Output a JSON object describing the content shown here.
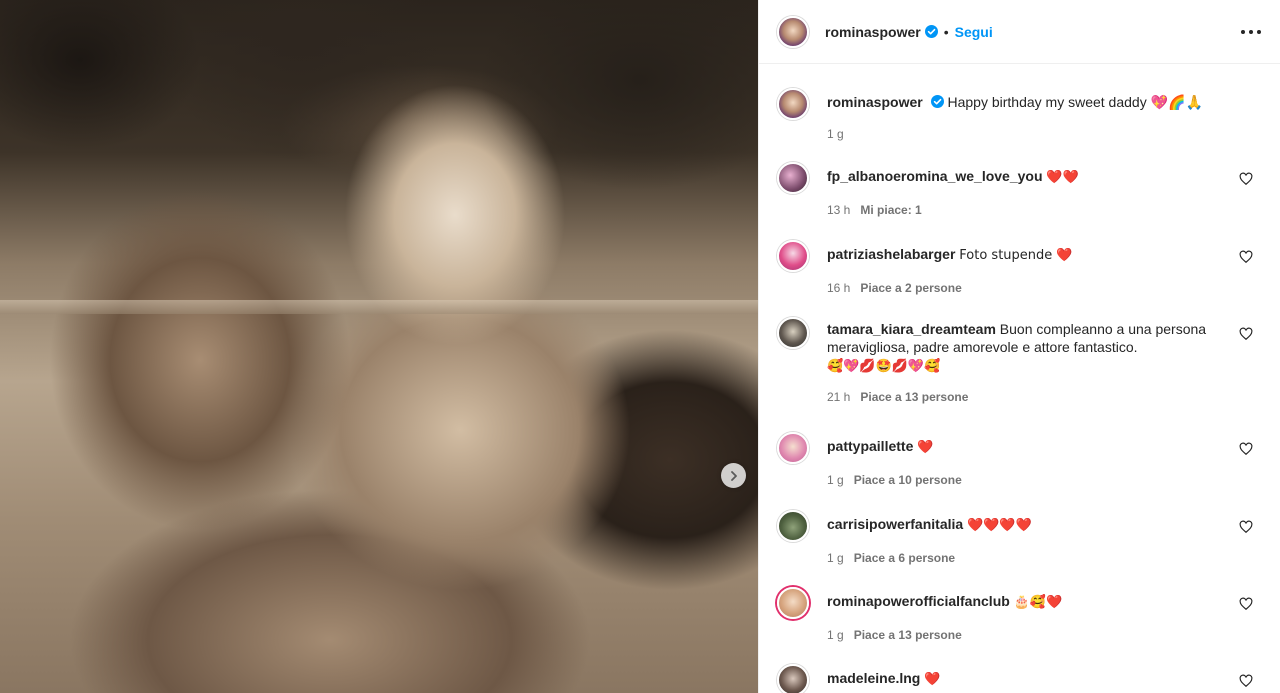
{
  "post": {
    "author": "rominaspower",
    "follow_label": "Segui",
    "separator": "•"
  },
  "caption": {
    "author": "rominaspower",
    "text": "Happy birthday my sweet daddy 💖🌈🙏",
    "time": "1 g"
  },
  "comments": [
    {
      "user": "fp_albanoeromina_we_love_you",
      "text": "❤️❤️",
      "time": "13 h",
      "likes": "Mi piace: 1"
    },
    {
      "user": "patriziashelabarger",
      "text": "Foto stupende ❤️",
      "time": "16 h",
      "likes": "Piace a 2 persone"
    },
    {
      "user": "tamara_kiara_dreamteam",
      "text": "Buon compleanno a una persona meravigliosa, padre amorevole e attore fantastico.",
      "text2": "🥰💖💋🤩💋💖🥰",
      "time": "21 h",
      "likes": "Piace a 13 persone"
    },
    {
      "user": "pattypaillette",
      "text": "❤️",
      "time": "1 g",
      "likes": "Piace a 10 persone"
    },
    {
      "user": "carrisipowerfanitalia",
      "text": "❤️❤️❤️❤️",
      "time": "1 g",
      "likes": "Piace a 6 persone"
    },
    {
      "user": "rominapowerofficialfanclub",
      "text": "🎂🥰❤️",
      "time": "1 g",
      "likes": "Piace a 13 persone"
    },
    {
      "user": "madeleine.lng",
      "text": "❤️",
      "time": "",
      "likes": ""
    }
  ],
  "colors": {
    "accent": "#0095f6",
    "muted": "#737373",
    "text": "#262626",
    "divider": "#efefef"
  },
  "icons": [
    "verified-badge-icon",
    "more-options-icon",
    "heart-outline-icon",
    "chevron-right-icon"
  ]
}
